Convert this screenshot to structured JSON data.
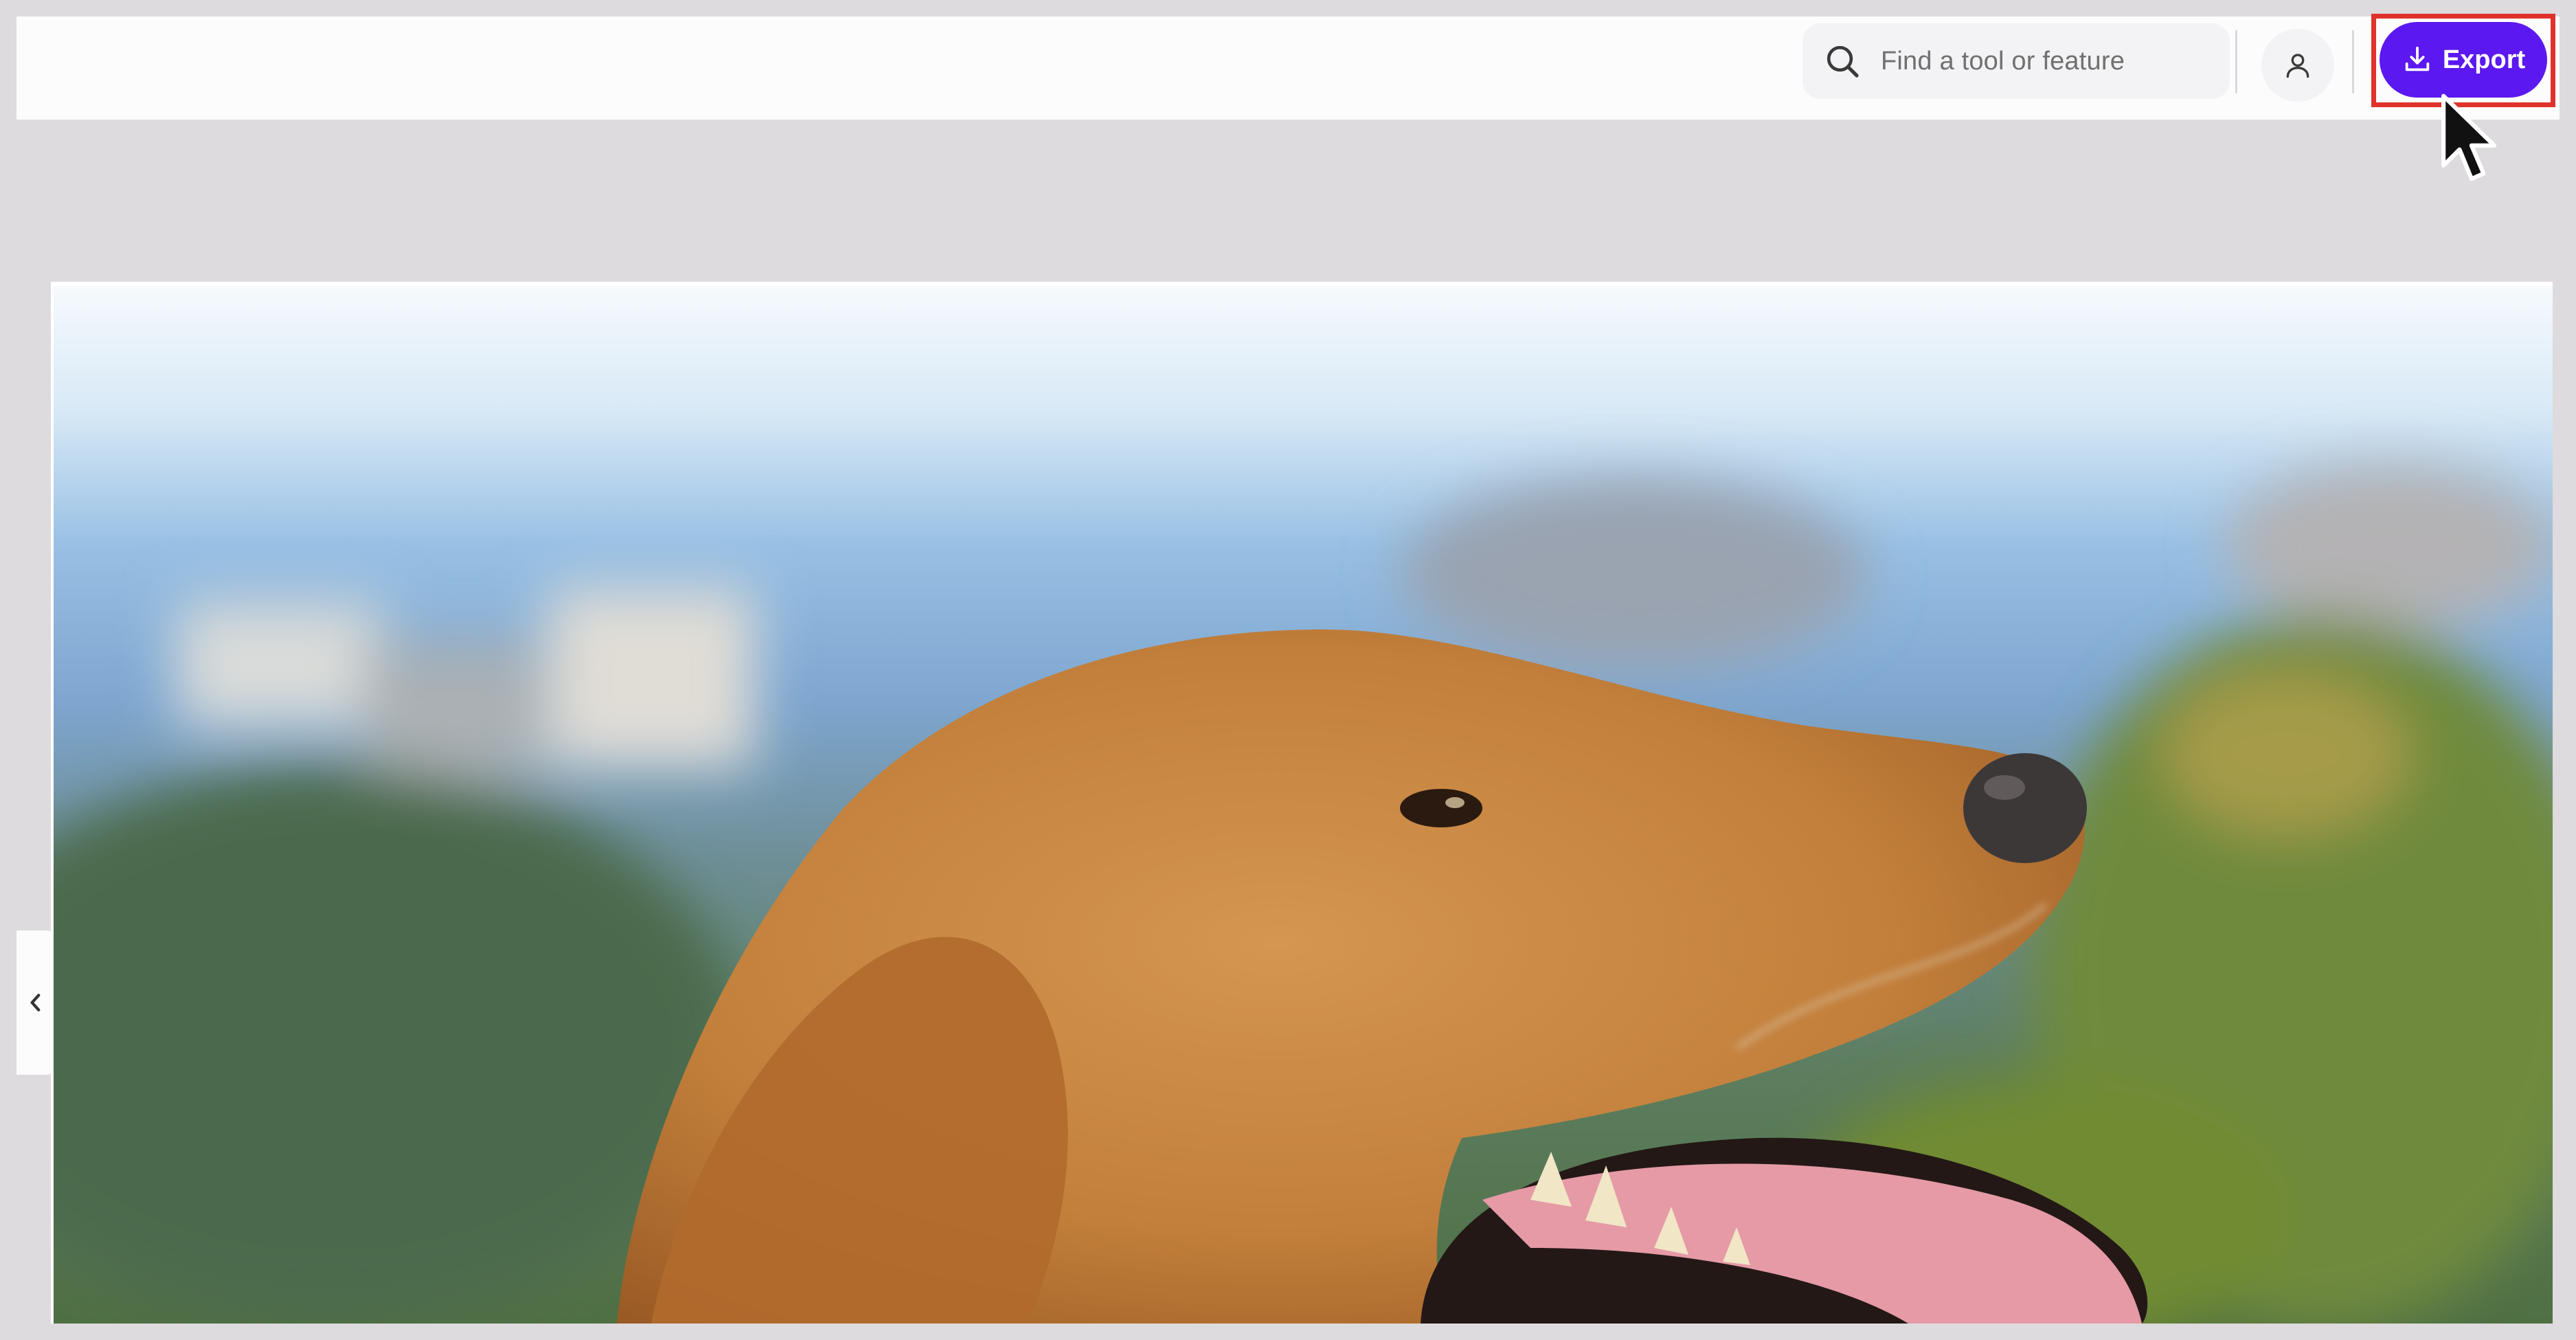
{
  "header": {
    "search": {
      "placeholder": "Find a tool or feature",
      "icon": "search-icon"
    },
    "profile": {
      "icon": "user-icon"
    },
    "export": {
      "label": "Export",
      "icon": "download-icon",
      "color": "#5b18f0",
      "highlight_color": "#e0322c"
    }
  },
  "sidebar_toggle": {
    "icon": "chevron-left-icon"
  },
  "canvas": {
    "image": "golden retriever dog in profile with mouth open, blurred hills behind"
  }
}
